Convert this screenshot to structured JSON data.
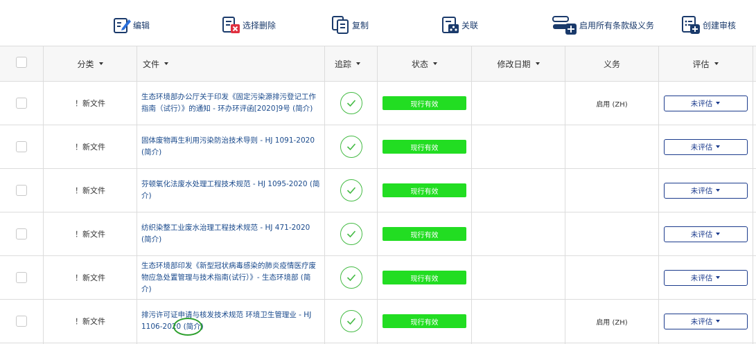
{
  "toolbar": {
    "edit": "编辑",
    "delete_selected": "选择删除",
    "copy": "复制",
    "link": "关联",
    "enable_all": "启用所有条款级义务",
    "create_review": "创建审核"
  },
  "table": {
    "headers": {
      "category": "分类",
      "file": "文件",
      "track": "追踪",
      "status": "状态",
      "modified": "修改日期",
      "duty": "义务",
      "evaluation": "评估"
    },
    "rows": [
      {
        "category": "！新文件",
        "file": "生态环境部办公厅关于印发《固定污染源排污登记工作指南（试行）》的通知 - 环办环评函[2020]9号 (简介)",
        "status": "现行有效",
        "modified": "",
        "duty": "启用 (ZH)",
        "evaluation": "未评估"
      },
      {
        "category": "！新文件",
        "file": "固体废物再生利用污染防治技术导则 - HJ 1091-2020 (简介)",
        "status": "现行有效",
        "modified": "",
        "duty": "",
        "evaluation": "未评估"
      },
      {
        "category": "！新文件",
        "file": "芬顿氧化法废水处理工程技术规范 - HJ 1095-2020 (简介)",
        "status": "现行有效",
        "modified": "",
        "duty": "",
        "evaluation": "未评估"
      },
      {
        "category": "！新文件",
        "file": "纺织染整工业废水治理工程技术规范 - HJ 471-2020 (简介)",
        "status": "现行有效",
        "modified": "",
        "duty": "",
        "evaluation": "未评估"
      },
      {
        "category": "！新文件",
        "file": "生态环境部印发《新型冠状病毒感染的肺炎疫情医疗废物应急处置管理与技术指南(试行）》- 生态环境部 (简介)",
        "status": "现行有效",
        "modified": "",
        "duty": "",
        "evaluation": "未评估"
      },
      {
        "category": "！新文件",
        "file": "排污许可证申请与核发技术规范 环境卫生管理业 - HJ 1106-2020 (简介)",
        "status": "现行有效",
        "modified": "",
        "duty": "启用 (ZH)",
        "evaluation": "未评估"
      }
    ]
  },
  "colors": {
    "status_green": "#22dd22",
    "link_blue": "#1a4a8c",
    "check_green": "#44bb44",
    "delete_red": "#e03040",
    "highlight_green": "#2ea02e"
  },
  "icons": {
    "edit": "edit-icon",
    "delete": "delete-icon",
    "copy": "copy-icon",
    "link": "link-icon",
    "enable": "enable-duty-icon",
    "review": "create-review-icon",
    "track": "check-icon"
  }
}
